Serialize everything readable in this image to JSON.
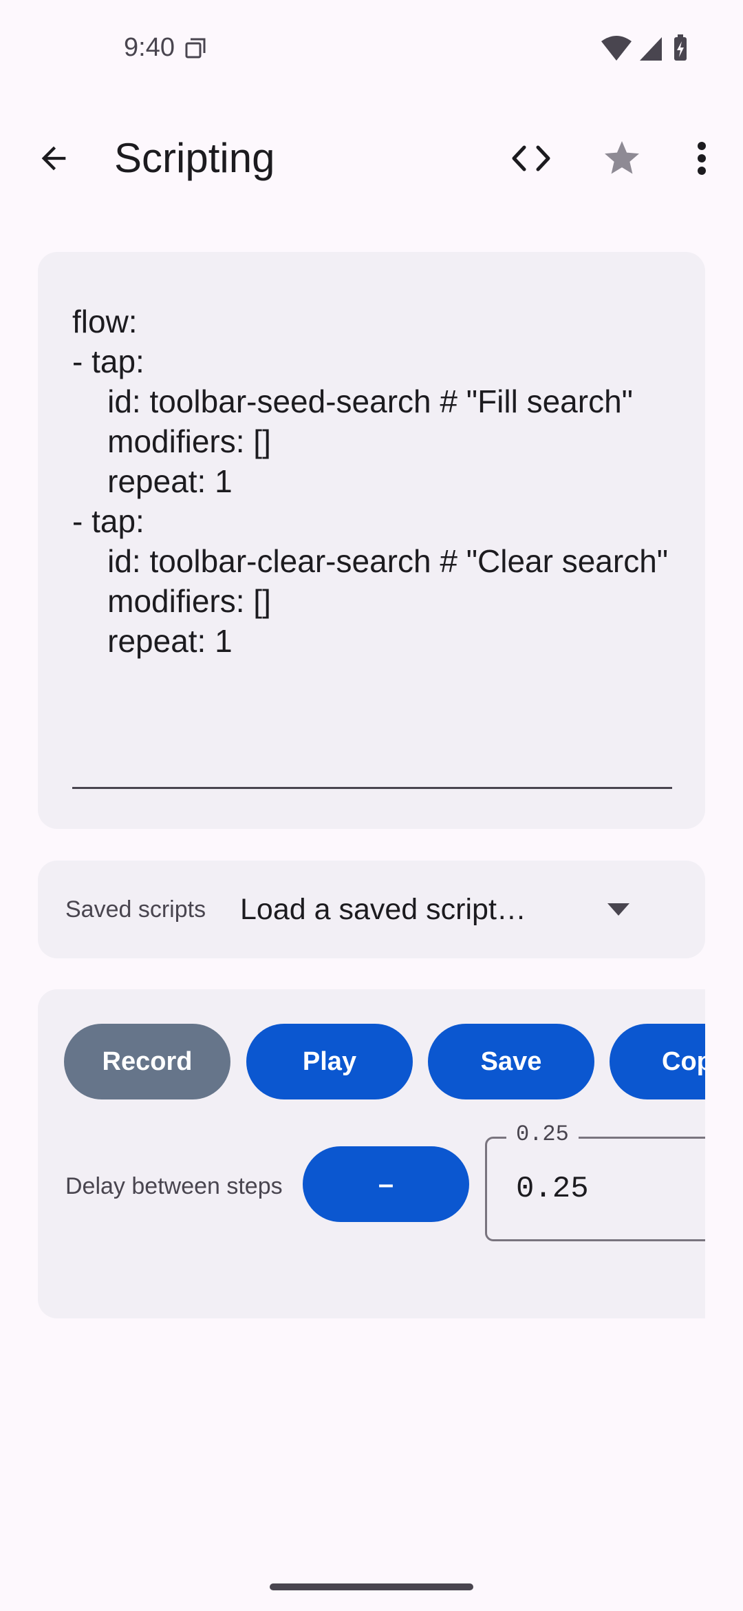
{
  "status_bar": {
    "time": "9:40",
    "icons": [
      "notification-icon",
      "wifi-icon",
      "signal-icon",
      "battery-icon"
    ]
  },
  "app_bar": {
    "title": "Scripting",
    "icons": [
      "back-arrow-icon",
      "code-icon",
      "star-icon",
      "more-vert-icon"
    ]
  },
  "editor": {
    "content": "flow:\n- tap:\n    id: toolbar-seed-search # \"Fill search\"\n    modifiers: []\n    repeat: 1\n- tap:\n    id: toolbar-clear-search # \"Clear search\"\n    modifiers: []\n    repeat: 1"
  },
  "saved_scripts": {
    "label": "Saved scripts",
    "selected": "Load a saved script…"
  },
  "controls": {
    "record_label": "Record",
    "play_label": "Play",
    "save_label": "Save",
    "copy_label": "Copy",
    "delay_label": "Delay between steps",
    "minus_label": "–",
    "delay_field_label": "0.25",
    "delay_value": "0.25"
  },
  "colors": {
    "background": "#fdf8fd",
    "surface": "#f2eff5",
    "primary": "#0b57d0",
    "record_button": "#66758a",
    "star_icon": "#8e8a94"
  }
}
